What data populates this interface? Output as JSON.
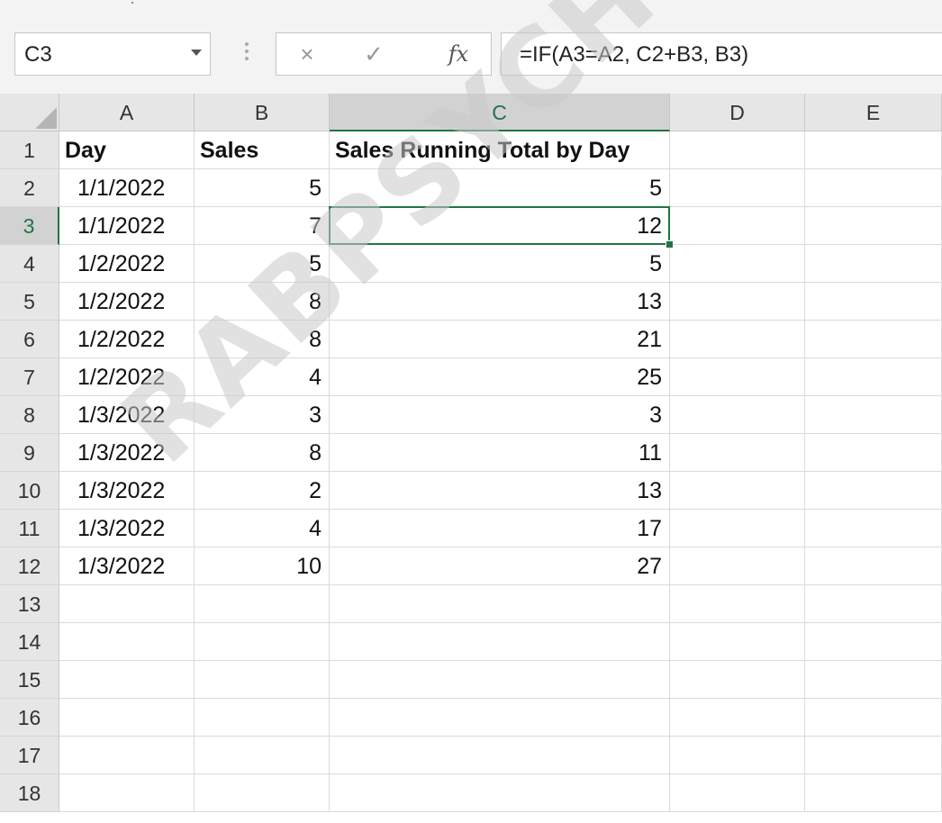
{
  "name_box": {
    "value": "C3"
  },
  "formula_bar": {
    "cancel_icon": "×",
    "enter_icon": "✓",
    "function_icon": "fx",
    "formula": "=IF(A3=A2, C2+B3, B3)"
  },
  "columns": [
    {
      "label": "A",
      "selected": false
    },
    {
      "label": "B",
      "selected": false
    },
    {
      "label": "C",
      "selected": true
    },
    {
      "label": "D",
      "selected": false
    },
    {
      "label": "E",
      "selected": false
    }
  ],
  "rows": [
    {
      "num": "1",
      "selected": false,
      "cells": [
        "Day",
        "Sales",
        "Sales Running Total by Day",
        "",
        ""
      ]
    },
    {
      "num": "2",
      "selected": false,
      "cells": [
        "1/1/2022",
        "5",
        "5",
        "",
        ""
      ]
    },
    {
      "num": "3",
      "selected": true,
      "cells": [
        "1/1/2022",
        "7",
        "12",
        "",
        ""
      ]
    },
    {
      "num": "4",
      "selected": false,
      "cells": [
        "1/2/2022",
        "5",
        "5",
        "",
        ""
      ]
    },
    {
      "num": "5",
      "selected": false,
      "cells": [
        "1/2/2022",
        "8",
        "13",
        "",
        ""
      ]
    },
    {
      "num": "6",
      "selected": false,
      "cells": [
        "1/2/2022",
        "8",
        "21",
        "",
        ""
      ]
    },
    {
      "num": "7",
      "selected": false,
      "cells": [
        "1/2/2022",
        "4",
        "25",
        "",
        ""
      ]
    },
    {
      "num": "8",
      "selected": false,
      "cells": [
        "1/3/2022",
        "3",
        "3",
        "",
        ""
      ]
    },
    {
      "num": "9",
      "selected": false,
      "cells": [
        "1/3/2022",
        "8",
        "11",
        "",
        ""
      ]
    },
    {
      "num": "10",
      "selected": false,
      "cells": [
        "1/3/2022",
        "2",
        "13",
        "",
        ""
      ]
    },
    {
      "num": "11",
      "selected": false,
      "cells": [
        "1/3/2022",
        "4",
        "17",
        "",
        ""
      ]
    },
    {
      "num": "12",
      "selected": false,
      "cells": [
        "1/3/2022",
        "10",
        "27",
        "",
        ""
      ]
    },
    {
      "num": "13",
      "selected": false,
      "cells": [
        "",
        "",
        "",
        "",
        ""
      ]
    },
    {
      "num": "14",
      "selected": false,
      "cells": [
        "",
        "",
        "",
        "",
        ""
      ]
    },
    {
      "num": "15",
      "selected": false,
      "cells": [
        "",
        "",
        "",
        "",
        ""
      ]
    },
    {
      "num": "16",
      "selected": false,
      "cells": [
        "",
        "",
        "",
        "",
        ""
      ]
    },
    {
      "num": "17",
      "selected": false,
      "cells": [
        "",
        "",
        "",
        "",
        ""
      ]
    },
    {
      "num": "18",
      "selected": false,
      "cells": [
        "",
        "",
        "",
        "",
        ""
      ]
    }
  ],
  "watermark": {
    "text": "RABPSYCHOLOGY.CO"
  },
  "colors": {
    "accent": "#217346"
  }
}
